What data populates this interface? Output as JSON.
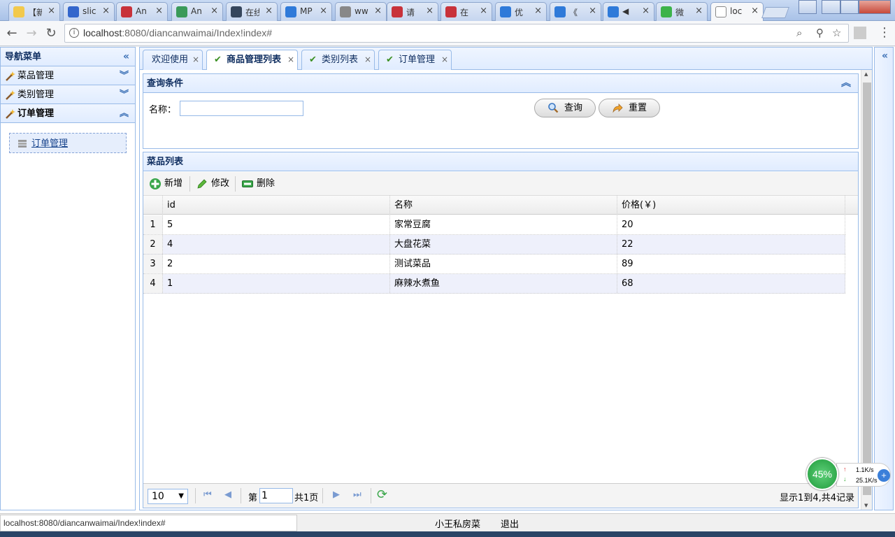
{
  "browser": {
    "tabs": [
      {
        "title": "【新",
        "color": "#f2c94c"
      },
      {
        "title": "slic",
        "color": "#3366cc"
      },
      {
        "title": "An",
        "color": "#c8323a"
      },
      {
        "title": "An",
        "color": "#3a9a5a"
      },
      {
        "title": "在线",
        "color": "#35465c"
      },
      {
        "title": "MP",
        "color": "#2f7ad9"
      },
      {
        "title": "ww",
        "color": "#888888"
      },
      {
        "title": "请",
        "color": "#c8323a"
      },
      {
        "title": "在",
        "color": "#c8323a"
      },
      {
        "title": "优",
        "color": "#2f7ad9"
      },
      {
        "title": "《",
        "color": "#2f7ad9"
      },
      {
        "title": "◀",
        "color": "#2f7ad9"
      },
      {
        "title": "微",
        "color": "#3cb34a"
      },
      {
        "title": "loc",
        "color": "#ffffff"
      }
    ],
    "url_host": "localhost",
    "url_rest": ":8080/diancanwaimai/Index!index#",
    "status_url": "localhost:8080/diancanwaimai/Index!index#"
  },
  "sidebar": {
    "title": "导航菜单",
    "sections": [
      {
        "label": "菜品管理"
      },
      {
        "label": "类别管理"
      },
      {
        "label": "订单管理"
      }
    ],
    "open_item": "订单管理"
  },
  "tabs": [
    {
      "label": "欢迎使用"
    },
    {
      "label": "商品管理列表"
    },
    {
      "label": "类别列表"
    },
    {
      "label": "订单管理"
    }
  ],
  "query": {
    "title": "查询条件",
    "name_label": "名称：",
    "name_value": "",
    "search_btn": "查询",
    "reset_btn": "重置"
  },
  "list": {
    "title": "菜品列表",
    "toolbar": {
      "add": "新增",
      "edit": "修改",
      "delete": "删除"
    },
    "columns": [
      "id",
      "名称",
      "价格(￥)"
    ],
    "rows": [
      {
        "n": "1",
        "id": "5",
        "name": "家常豆腐",
        "price": "20"
      },
      {
        "n": "2",
        "id": "4",
        "name": "大盘花菜",
        "price": "22"
      },
      {
        "n": "3",
        "id": "2",
        "name": "测试菜品",
        "price": "89"
      },
      {
        "n": "4",
        "id": "1",
        "name": "麻辣水煮鱼",
        "price": "68"
      }
    ]
  },
  "pager": {
    "page_size": "10",
    "page_prefix": "第",
    "page_value": "1",
    "page_total": "共1页",
    "info": "显示1到4,共4记录"
  },
  "footer": {
    "brand": "小王私房菜",
    "logout": "退出"
  },
  "network": {
    "percent": "45%",
    "up": "1.1K/s",
    "down": "25.1K/s"
  }
}
